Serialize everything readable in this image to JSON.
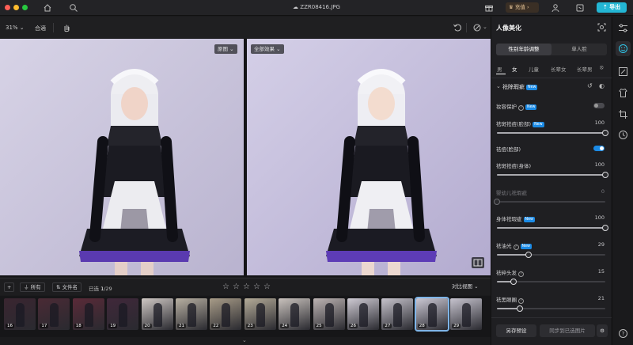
{
  "titlebar": {
    "filename": "ZZR08416.JPG",
    "vip_label": "充值",
    "export_label": "导出"
  },
  "toolbar": {
    "zoom": "31%",
    "fit_label": "合適"
  },
  "canvas": {
    "left_view_label": "原图",
    "right_view_label": "全部效果"
  },
  "filmbar": {
    "add_label": "+",
    "filter_label": "所有",
    "sort_label": "文件名",
    "selected_label": "已选",
    "selected_count": "1",
    "total_count": "/29",
    "compare_label": "对比视图"
  },
  "thumbnails": [
    {
      "num": "16",
      "bg": "#3a2530"
    },
    {
      "num": "17",
      "bg": "#4a2a35"
    },
    {
      "num": "18",
      "bg": "#5a2a38"
    },
    {
      "num": "19",
      "bg": "#40283a"
    },
    {
      "num": "20",
      "bg": "#cfc8c4"
    },
    {
      "num": "21",
      "bg": "#b8b0a2"
    },
    {
      "num": "22",
      "bg": "#a89c88"
    },
    {
      "num": "23",
      "bg": "#b4ab98"
    },
    {
      "num": "24",
      "bg": "#c9c2bd"
    },
    {
      "num": "25",
      "bg": "#bdb4b3"
    },
    {
      "num": "26",
      "bg": "#cfcbd4"
    },
    {
      "num": "27",
      "bg": "#c6c3cc"
    },
    {
      "num": "28",
      "bg": "#cbc8d4"
    },
    {
      "num": "29",
      "bg": "#c7c4cf"
    }
  ],
  "panel": {
    "title": "人像美化",
    "seg_gender_age": "性别年龄调整",
    "seg_single_face": "单人脸",
    "gender_tabs": [
      "男",
      "女",
      "儿童",
      "长辈女",
      "长辈男"
    ],
    "section_title": "祛除瑕疵",
    "new_badge": "New",
    "rows": {
      "makeup_protect": "妆容保护",
      "spot_face": "祛斑祛痘(脸部)",
      "spot_face_val": "100",
      "acne_face": "祛痘(脸部)",
      "spot_body": "祛斑祛痘(身体)",
      "spot_body_val": "100",
      "baby_acne": "婴幼儿祛瑕疵",
      "baby_acne_val": "0",
      "body_flaw": "身体祛瑕疵",
      "body_flaw_val": "100",
      "deshine": "祛油光",
      "deshine_val": "29",
      "flyaway_hair": "祛碎头发",
      "flyaway_hair_val": "15",
      "dark_circles": "祛黑眼圈",
      "dark_circles_val": "21"
    },
    "save_preset": "另存预设",
    "sync_selected": "同步到已选图片"
  },
  "colors": {
    "accent": "#23b6d4",
    "badge_blue": "#1b8be6",
    "toggle_on": "#1b8be6"
  }
}
